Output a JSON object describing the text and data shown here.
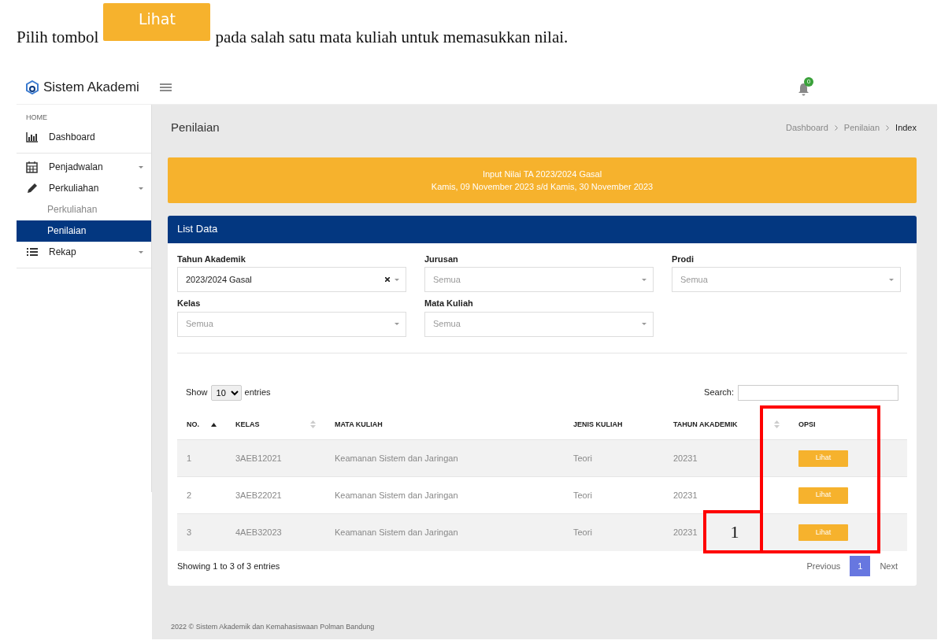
{
  "instruction": {
    "before": "Pilih tombol",
    "button": "Lihat",
    "after": "pada salah satu mata kuliah untuk memasukkan nilai."
  },
  "navbar": {
    "brand": "Sistem Akademi",
    "notification_count": "0"
  },
  "sidebar": {
    "section": "HOME",
    "groups": [
      {
        "items": [
          {
            "label": "Dashboard",
            "kind": "link"
          }
        ]
      },
      {
        "items": [
          {
            "label": "Penjadwalan",
            "kind": "dropdown"
          },
          {
            "label": "Perkuliahan",
            "kind": "dropdown",
            "children": [
              {
                "label": "Perkuliahan",
                "selected": false
              },
              {
                "label": "Penilaian",
                "selected": true
              }
            ]
          },
          {
            "label": "Rekap",
            "kind": "dropdown"
          }
        ]
      }
    ]
  },
  "page_title": "Penilaian",
  "breadcrumbs": [
    {
      "label": "Dashboard",
      "current": false
    },
    {
      "label": "Penilaian",
      "current": false
    },
    {
      "label": "Index",
      "current": true
    }
  ],
  "alert": {
    "lines": [
      "Input Nilai TA 2023/2024 Gasal",
      "Kamis, 09 November 2023 s/d Kamis, 30 November 2023"
    ]
  },
  "card": {
    "title": "List Data",
    "filters": [
      {
        "label": "Tahun Akademik",
        "value": "2023/2024 Gasal",
        "clearable": true
      },
      {
        "label": "Jurusan",
        "placeholder": "Semua",
        "clearable": false
      },
      {
        "label": "Prodi",
        "placeholder": "Semua",
        "clearable": false
      },
      {
        "label": "Kelas",
        "placeholder": "Semua",
        "clearable": false
      },
      {
        "label": "Mata Kuliah",
        "placeholder": "Semua",
        "clearable": false
      }
    ],
    "length": {
      "before": "Show",
      "value": "10",
      "after": "entries"
    },
    "search_label": "Search:",
    "columns": [
      {
        "label": "NO.",
        "kind": "sorted"
      },
      {
        "label": "KELAS",
        "kind": "sortable"
      },
      {
        "label": "MATA KULIAH",
        "kind": "plain"
      },
      {
        "label": "JENIS KULIAH",
        "kind": "plain"
      },
      {
        "label": "TAHUN AKADEMIK",
        "kind": "sortable"
      },
      {
        "label": "OPSI",
        "kind": "plain"
      }
    ],
    "rows": [
      {
        "cells": [
          "1",
          "3AEB12021",
          "Keamanan Sistem dan Jaringan",
          "Teori",
          "20231"
        ],
        "action": "Lihat"
      },
      {
        "cells": [
          "2",
          "3AEB22021",
          "Keamanan Sistem dan Jaringan",
          "Teori",
          "20231"
        ],
        "action": "Lihat"
      },
      {
        "cells": [
          "3",
          "4AEB32023",
          "Keamanan Sistem dan Jaringan",
          "Teori",
          "20231"
        ],
        "action": "Lihat"
      }
    ],
    "info": "Showing 1 to 3 of 3 entries",
    "pagination": [
      {
        "label": "Previous",
        "selected": false
      },
      {
        "label": "1",
        "selected": true
      },
      {
        "label": "Next",
        "selected": false
      }
    ]
  },
  "footer": "2022 © Sistem Akademik dan Kemahasiswaan Polman Bandung",
  "annotation": {
    "label": "1"
  }
}
